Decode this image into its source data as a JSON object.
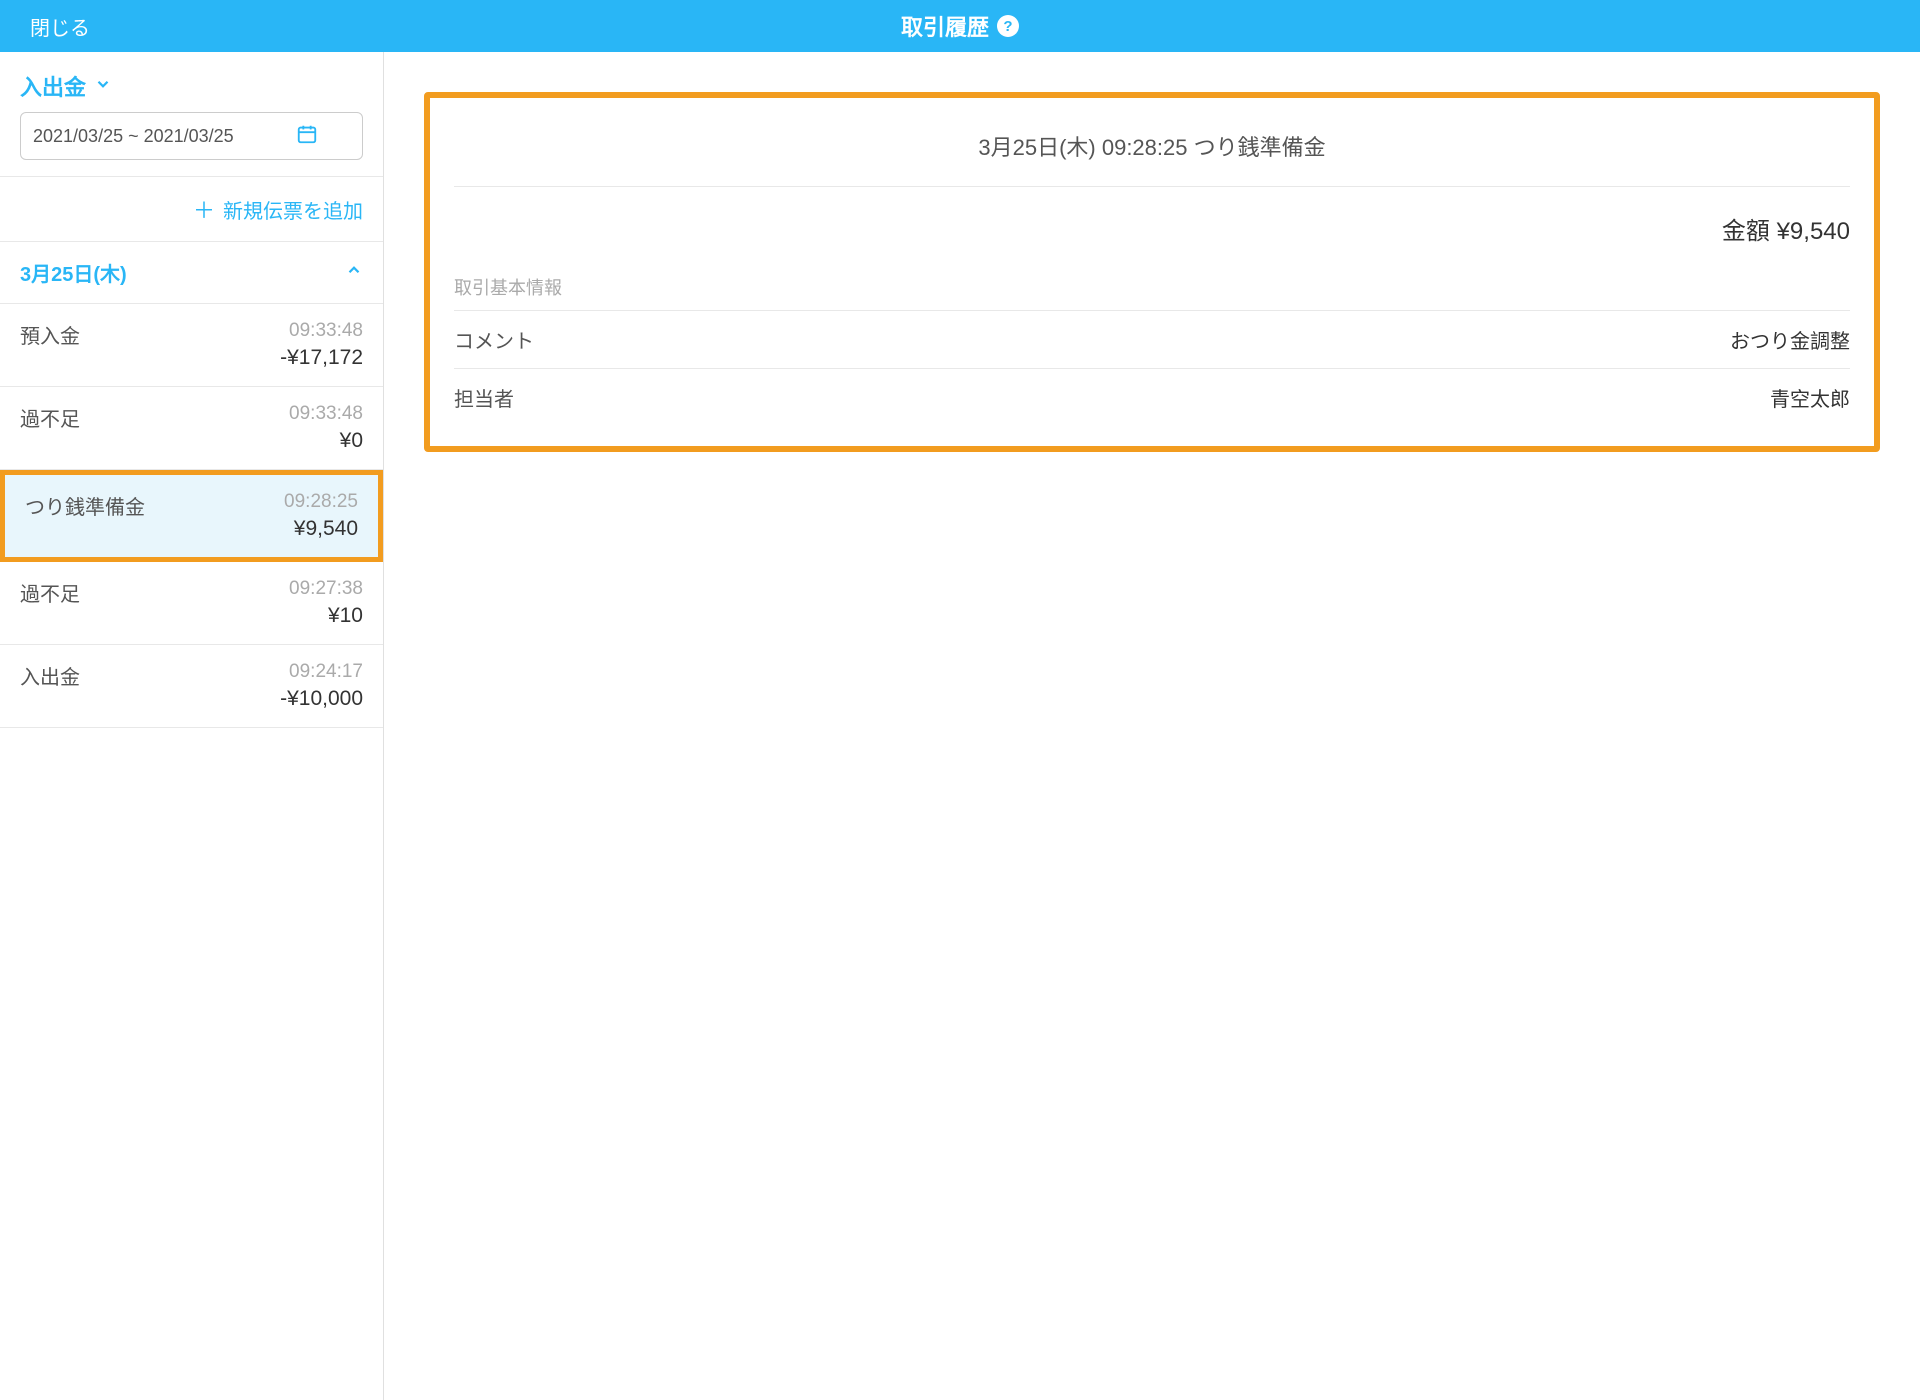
{
  "header": {
    "close": "閉じる",
    "title": "取引履歴"
  },
  "sidebar": {
    "filter_label": "入出金",
    "date_range": "2021/03/25 ~ 2021/03/25",
    "add_slip": "新規伝票を追加",
    "date_header": "3月25日(木)",
    "transactions": [
      {
        "label": "預入金",
        "time": "09:33:48",
        "amount": "-¥17,172"
      },
      {
        "label": "過不足",
        "time": "09:33:48",
        "amount": "¥0"
      },
      {
        "label": "つり銭準備金",
        "time": "09:28:25",
        "amount": "¥9,540"
      },
      {
        "label": "過不足",
        "time": "09:27:38",
        "amount": "¥10"
      },
      {
        "label": "入出金",
        "time": "09:24:17",
        "amount": "-¥10,000"
      }
    ]
  },
  "detail": {
    "title": "3月25日(木) 09:28:25 つり銭準備金",
    "amount_label": "金額 ¥9,540",
    "section_label": "取引基本情報",
    "rows": [
      {
        "key": "コメント",
        "val": "おつり金調整"
      },
      {
        "key": "担当者",
        "val": "青空太郎"
      }
    ]
  }
}
